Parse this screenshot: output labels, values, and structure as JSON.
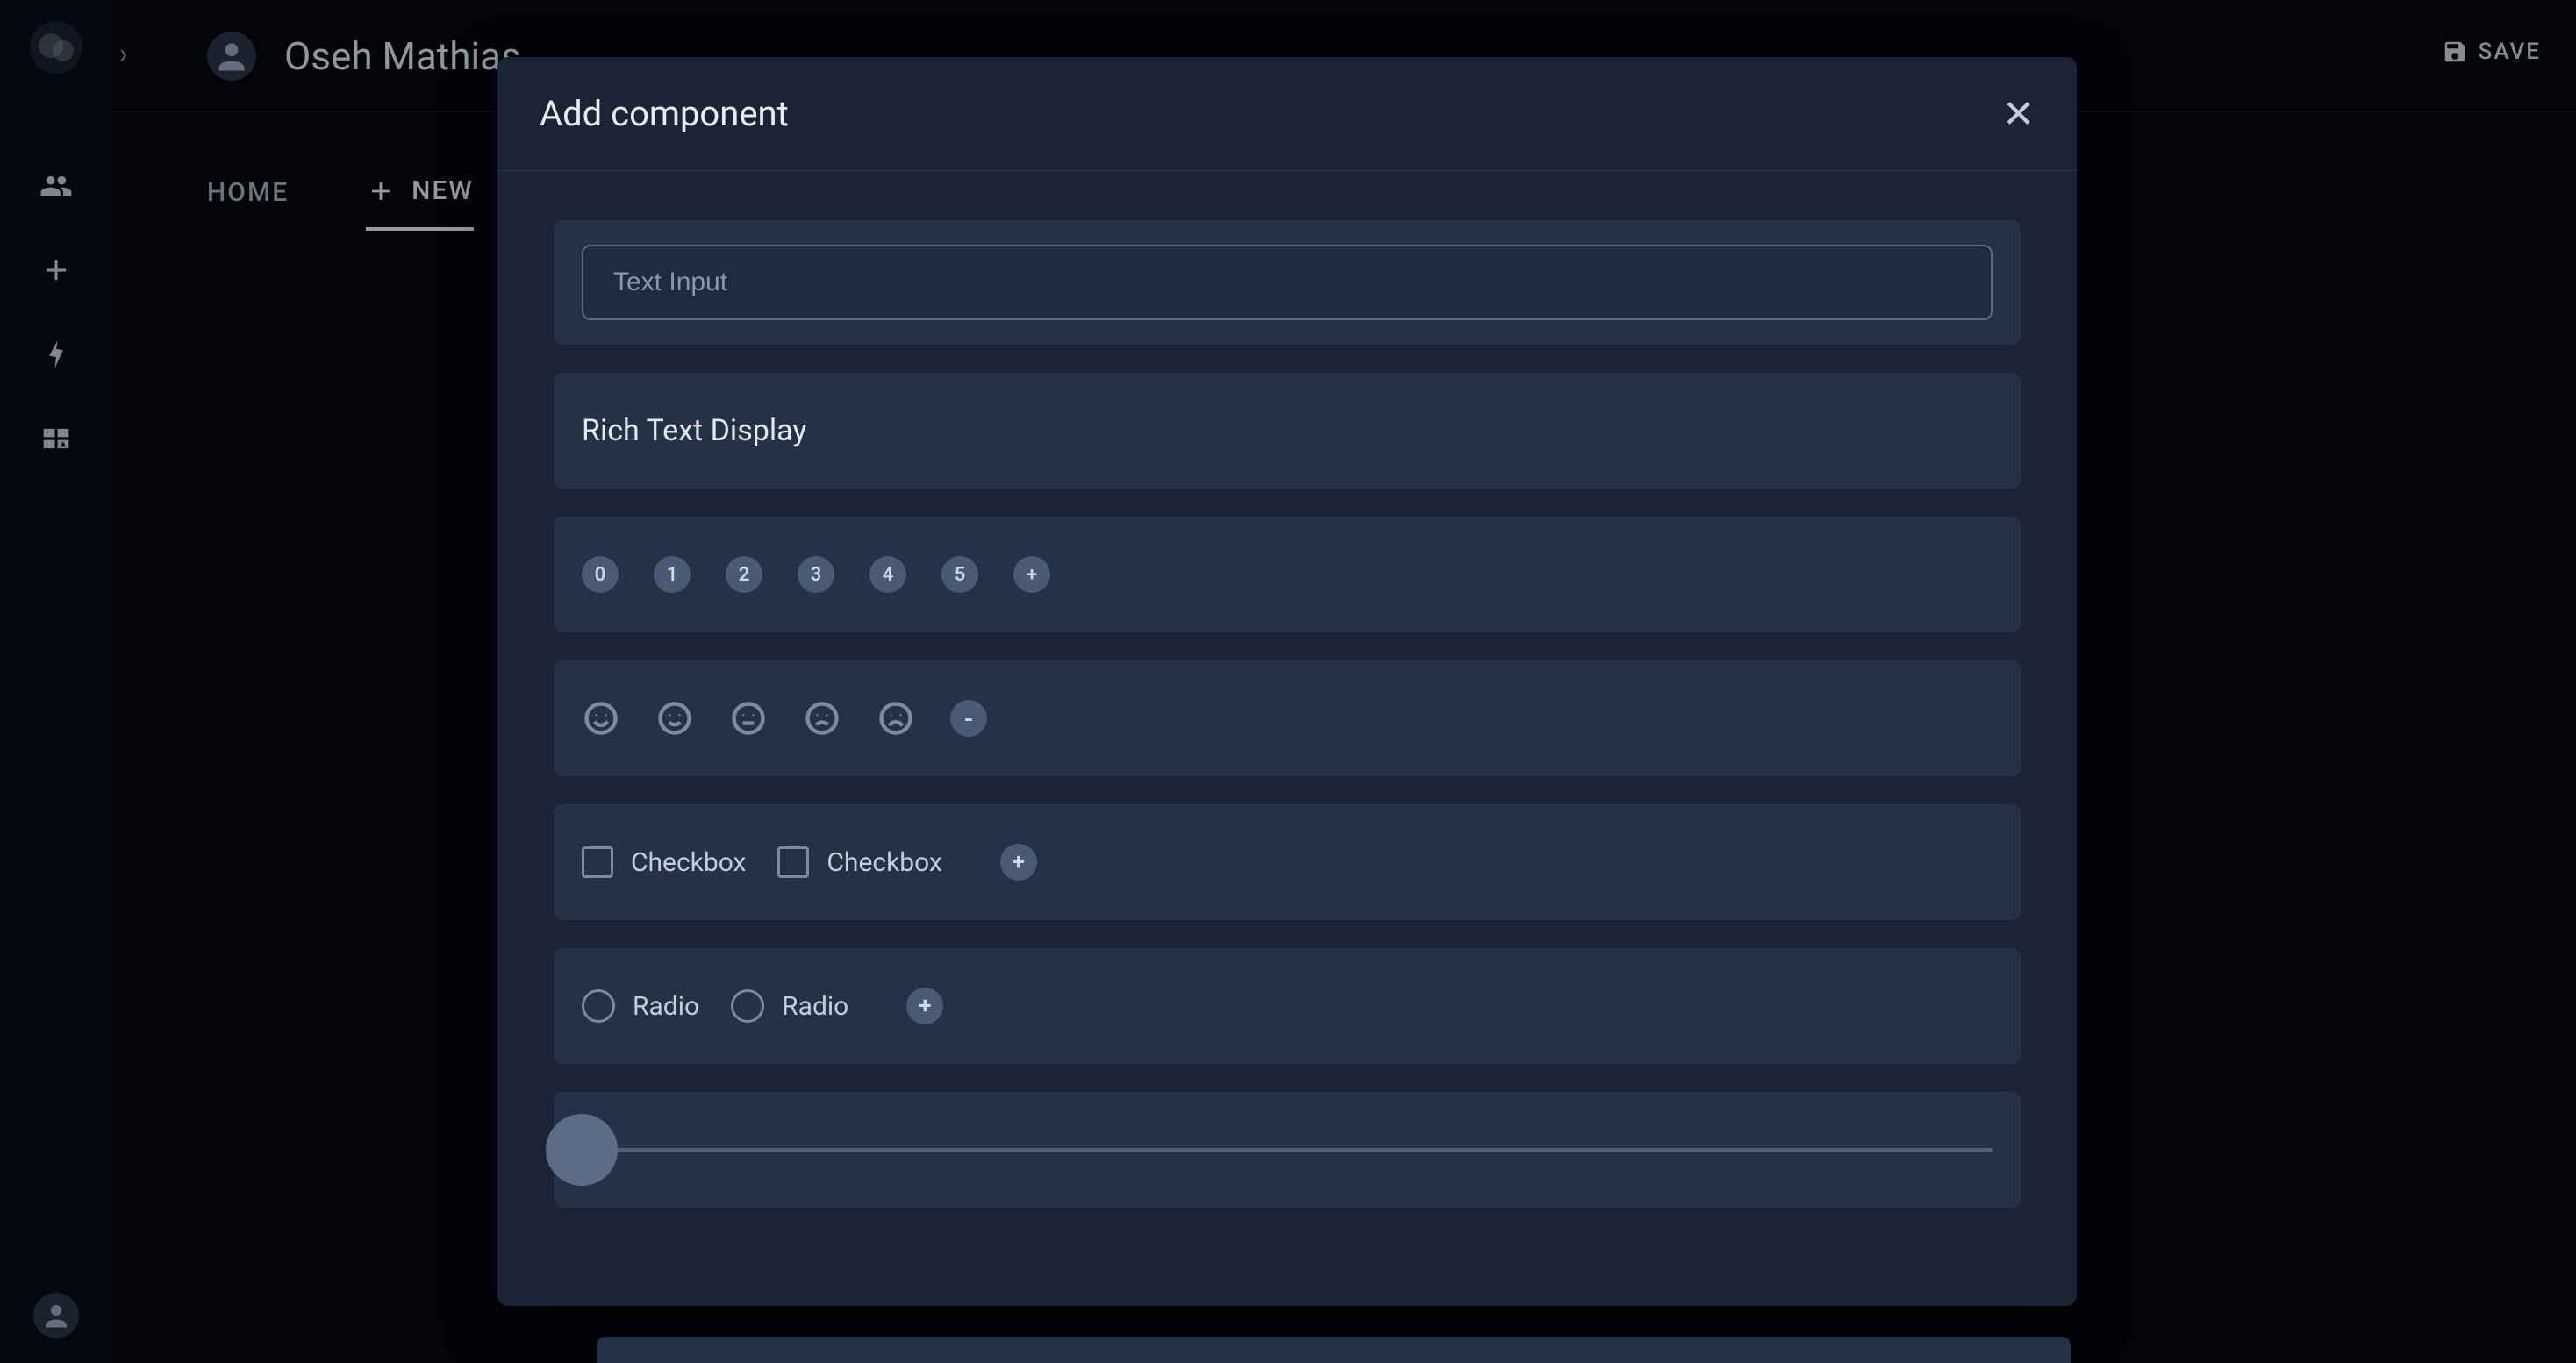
{
  "header": {
    "title": "Oseh Mathias",
    "save_label": "SAVE"
  },
  "tabs": {
    "home": "HOME",
    "new": "NEW"
  },
  "modal": {
    "title": "Add component",
    "text_input_placeholder": "Text Input",
    "rich_text_label": "Rich Text Display",
    "number_chips": [
      "0",
      "1",
      "2",
      "3",
      "4",
      "5",
      "+"
    ],
    "emoji_minus": "-",
    "checkbox_label": "Checkbox",
    "checkbox_add": "+",
    "radio_label": "Radio",
    "radio_add": "+"
  }
}
